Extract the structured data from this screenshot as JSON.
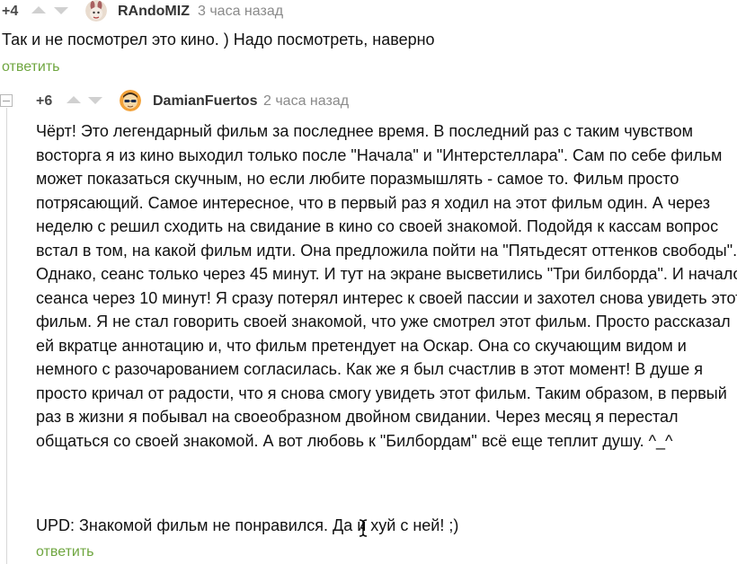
{
  "comments": [
    {
      "rating": "+4",
      "username": "RAndoMIZ",
      "time": "3 часа назад",
      "text": "Так и не посмотрел это кино. ) Надо посмотреть, наверно",
      "reply_label": "ответить",
      "avatar_icon": "avatar-bunny-icon"
    },
    {
      "rating": "+6",
      "username": "DamianFuertos",
      "time": "2 часа назад",
      "lines": [
        "Чёрт! Это легендарный фильм за последнее время. В последний раз с таким чувством",
        "восторга я из кино выходил только после \"Начала\" и \"Интерстеллара\". Сам по себе фильм",
        "может показаться скучным, но если любите поразмышлять - самое то. Фильм просто",
        "потрясающий. Самое интересное, что в первый раз я ходил на этот фильм один. А через",
        "неделю с решил сходить на свидание в кино со своей знакомой. Подойдя к кассам вопрос",
        "встал в том, на какой фильм идти. Она предложила пойти на \"Пятьдесят оттенков свободы\".",
        "Однако, сеанс только через 45 минут. И тут на экране высветились \"Три билборда\". И начало",
        "сеанса через 10 минут! Я сразу потерял интерес к своей пассии и захотел снова увидеть этот",
        "фильм. Я не стал говорить своей знакомой, что уже смотрел этот фильм. Просто рассказал",
        "ей вкратце аннотацию и, что фильм претендует на Оскар. Она со скучающим видом и",
        "немного с разочарованием согласилась. Как же я был счастлив в этот момент! В душе я",
        "просто кричал от радости, что я снова смогу увидеть этот фильм. Таким образом, в первый",
        "раз в жизни я побывал на своеобразном двойном свидании. Через месяц я перестал",
        "общаться со своей знакомой. А вот любовь к \"Билбордам\" всё еще теплит душу. ^_^"
      ],
      "upd_text": "UPD: Знакомой фильм не понравился. Да и хуй с ней! ;)",
      "reply_label": "ответить",
      "avatar_icon": "avatar-sunglasses-icon"
    }
  ],
  "colors": {
    "reply_link": "#6fa640",
    "username": "#333333",
    "time": "#8a8a8a",
    "arrow": "#d0d0d0"
  },
  "icons": {
    "vote_up": "arrow-up-icon",
    "vote_down": "arrow-down-icon",
    "collapse": "collapse-icon",
    "cursor": "text-cursor-icon"
  }
}
